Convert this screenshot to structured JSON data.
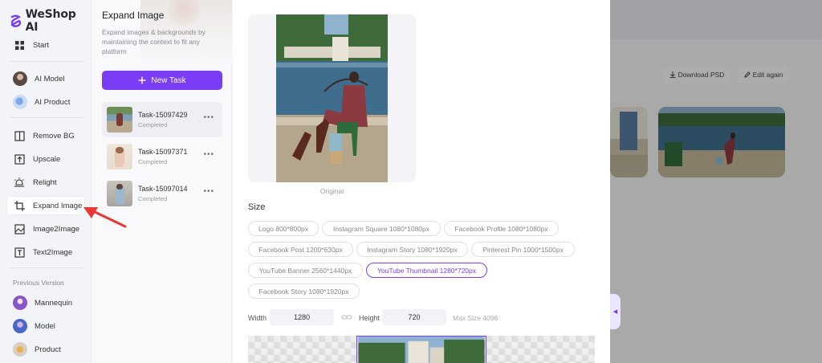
{
  "brand": {
    "name": "WeShop AI",
    "color": "#7a3cf5"
  },
  "nav": {
    "start": "Start",
    "ai_model": "AI Model",
    "ai_product": "AI Product",
    "remove_bg": "Remove BG",
    "upscale": "Upscale",
    "relight": "Relight",
    "expand_image": "Expand Image",
    "image2image": "Image2Image",
    "text2image": "Text2Image",
    "previous_version": "Previous Version",
    "mannequin": "Mannequin",
    "model": "Model",
    "product": "Product"
  },
  "tasks_panel": {
    "title": "Expand Image",
    "description": "Expand images & backgrounds by maintaining the context to fit any platform",
    "new_task": "New Task",
    "items": [
      {
        "name": "Task-15097429",
        "status": "Completed"
      },
      {
        "name": "Task-15097371",
        "status": "Completed"
      },
      {
        "name": "Task-15097014",
        "status": "Completed"
      }
    ]
  },
  "main": {
    "original_caption": "Original",
    "size_title": "Size",
    "presets": [
      "Logo 800*800px",
      "Instagram Square 1080*1080px",
      "Facebook Profile 1080*1080px",
      "Facebook Post 1200*630px",
      "Instagram Story 1080*1920px",
      "Pinterest Pin 1000*1500px",
      "YouTube Banner 2560*1440px",
      "YouTube Thumbnail 1280*720px",
      "Facebook Story 1080*1920px"
    ],
    "selected_preset": "YouTube Thumbnail 1280*720px",
    "width_label": "Width",
    "width_value": "1280",
    "height_label": "Height",
    "height_value": "720",
    "max_size": "Max Size 4096"
  },
  "results": {
    "download_psd": "Download PSD",
    "edit_again": "Edit again"
  }
}
